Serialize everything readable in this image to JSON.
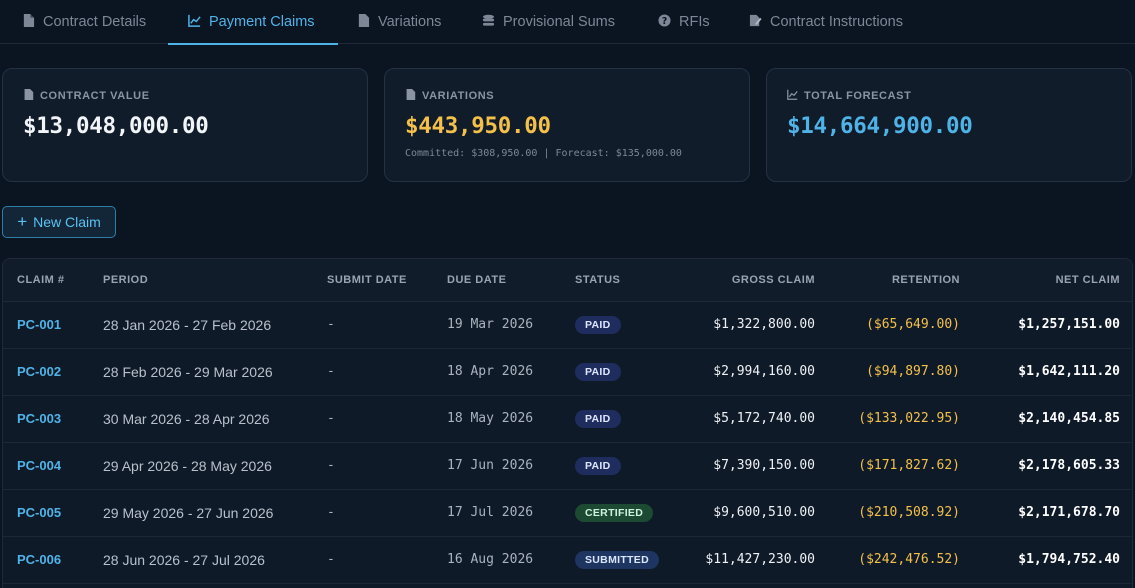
{
  "tabs": [
    {
      "label": "Contract Details",
      "icon": "document-icon"
    },
    {
      "label": "Payment Claims",
      "icon": "chart-line-icon"
    },
    {
      "label": "Variations",
      "icon": "document-icon"
    },
    {
      "label": "Provisional Sums",
      "icon": "coins-icon"
    },
    {
      "label": "RFIs",
      "icon": "question-circle-icon"
    },
    {
      "label": "Contract Instructions",
      "icon": "edit-document-icon"
    }
  ],
  "active_tab": "Payment Claims",
  "cards": {
    "contract_value": {
      "label": "CONTRACT VALUE",
      "value": "$13,048,000.00"
    },
    "variations": {
      "label": "VARIATIONS",
      "value": "$443,950.00",
      "sub": "Committed: $308,950.00 | Forecast: $135,000.00"
    },
    "total_forecast": {
      "label": "TOTAL FORECAST",
      "value": "$14,664,900.00"
    }
  },
  "new_claim_label": "New Claim",
  "table": {
    "headers": [
      "CLAIM #",
      "PERIOD",
      "SUBMIT DATE",
      "DUE DATE",
      "STATUS",
      "GROSS CLAIM",
      "RETENTION",
      "NET CLAIM"
    ],
    "rows": [
      {
        "claim": "PC-001",
        "period": "28 Jan 2026 - 27 Feb 2026",
        "submit": "-",
        "due": "19 Mar 2026",
        "status": "PAID",
        "gross": "$1,322,800.00",
        "retention": "($65,649.00)",
        "net": "$1,257,151.00"
      },
      {
        "claim": "PC-002",
        "period": "28 Feb 2026 - 29 Mar 2026",
        "submit": "-",
        "due": "18 Apr 2026",
        "status": "PAID",
        "gross": "$2,994,160.00",
        "retention": "($94,897.80)",
        "net": "$1,642,111.20"
      },
      {
        "claim": "PC-003",
        "period": "30 Mar 2026 - 28 Apr 2026",
        "submit": "-",
        "due": "18 May 2026",
        "status": "PAID",
        "gross": "$5,172,740.00",
        "retention": "($133,022.95)",
        "net": "$2,140,454.85"
      },
      {
        "claim": "PC-004",
        "period": "29 Apr 2026 - 28 May 2026",
        "submit": "-",
        "due": "17 Jun 2026",
        "status": "PAID",
        "gross": "$7,390,150.00",
        "retention": "($171,827.62)",
        "net": "$2,178,605.33"
      },
      {
        "claim": "PC-005",
        "period": "29 May 2026 - 27 Jun 2026",
        "submit": "-",
        "due": "17 Jul 2026",
        "status": "CERTIFIED",
        "gross": "$9,600,510.00",
        "retention": "($210,508.92)",
        "net": "$2,171,678.70"
      },
      {
        "claim": "PC-006",
        "period": "28 Jun 2026 - 27 Jul 2026",
        "submit": "-",
        "due": "16 Aug 2026",
        "status": "SUBMITTED",
        "gross": "$11,427,230.00",
        "retention": "($242,476.52)",
        "net": "$1,794,752.40"
      }
    ]
  }
}
